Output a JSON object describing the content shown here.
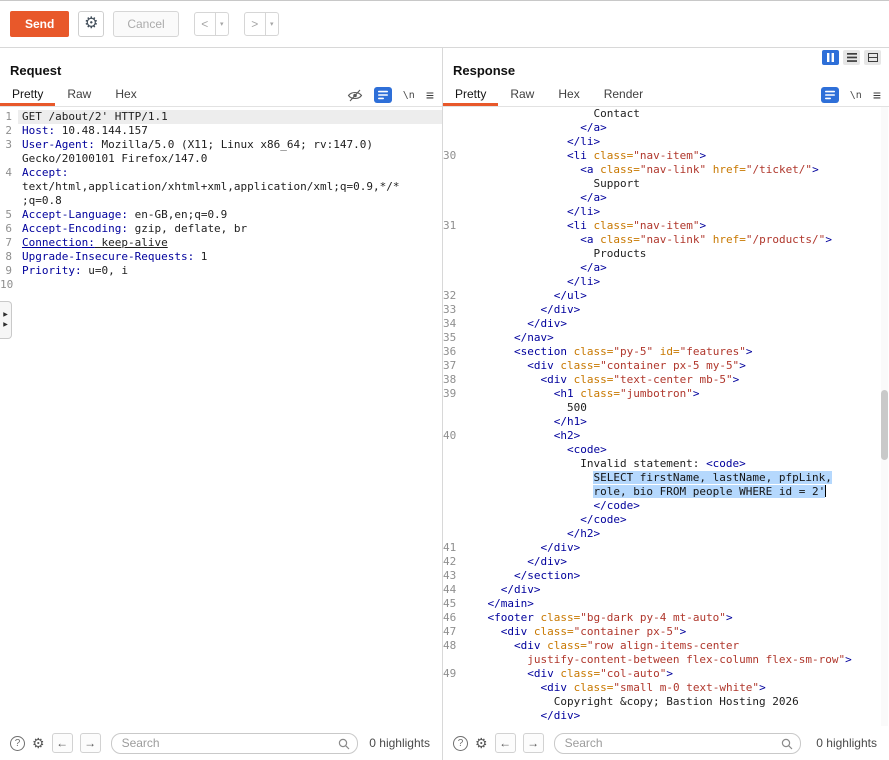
{
  "colors": {
    "accent_orange": "#e8582a",
    "selection_blue": "#b5d8fd",
    "button_blue": "#2e6fd8"
  },
  "icons": {
    "gear_glyph": "⚙",
    "menu_glyph": "≡",
    "newline_label": "\\n",
    "help_glyph": "?",
    "prev_arrow": "←",
    "next_arrow": "→",
    "expand_glyph": "▶"
  },
  "toolbar": {
    "send": "Send",
    "cancel": "Cancel",
    "prev": "<",
    "next": ">",
    "dropdown_caret": "▾"
  },
  "request": {
    "title": "Request",
    "tabs": [
      {
        "label": "Pretty",
        "active": true
      },
      {
        "label": "Raw",
        "active": false
      },
      {
        "label": "Hex",
        "active": false
      }
    ],
    "footer": {
      "search_placeholder": "Search",
      "highlights_label": "0 highlights"
    },
    "lines": [
      {
        "n": "1",
        "hl": true,
        "t": [
          [
            "p",
            "GET /about/2' HTTP/1.1"
          ]
        ]
      },
      {
        "n": "2",
        "t": [
          [
            "h",
            "Host:"
          ],
          [
            "v",
            " 10.48.144.157"
          ]
        ]
      },
      {
        "n": "3",
        "t": [
          [
            "h",
            "User-Agent:"
          ],
          [
            "v",
            " Mozilla/5.0 (X11; Linux x86_64; rv:147.0)"
          ]
        ]
      },
      {
        "n": "",
        "t": [
          [
            "v",
            "Gecko/20100101 Firefox/147.0"
          ]
        ]
      },
      {
        "n": "4",
        "t": [
          [
            "h",
            "Accept:"
          ]
        ]
      },
      {
        "n": "",
        "t": [
          [
            "v",
            "text/html,application/xhtml+xml,application/xml;q=0.9,*/*"
          ]
        ]
      },
      {
        "n": "",
        "t": [
          [
            "v",
            ";q=0.8"
          ]
        ]
      },
      {
        "n": "5",
        "t": [
          [
            "h",
            "Accept-Language:"
          ],
          [
            "v",
            " en-GB,en;q=0.9"
          ]
        ]
      },
      {
        "n": "6",
        "t": [
          [
            "h",
            "Accept-Encoding:"
          ],
          [
            "v",
            " gzip, deflate, br"
          ]
        ]
      },
      {
        "n": "7",
        "t": [
          [
            "hu",
            "Connection:"
          ],
          [
            "vu",
            " keep-alive"
          ]
        ]
      },
      {
        "n": "8",
        "t": [
          [
            "h",
            "Upgrade-Insecure-Requests:"
          ],
          [
            "v",
            " 1"
          ]
        ]
      },
      {
        "n": "9",
        "t": [
          [
            "h",
            "Priority:"
          ],
          [
            "v",
            " u=0, i"
          ]
        ]
      },
      {
        "n": "10",
        "t": []
      }
    ]
  },
  "response": {
    "title": "Response",
    "tabs": [
      {
        "label": "Pretty",
        "active": true
      },
      {
        "label": "Raw",
        "active": false
      },
      {
        "label": "Hex",
        "active": false
      },
      {
        "label": "Render",
        "active": false
      }
    ],
    "footer": {
      "search_placeholder": "Search",
      "highlights_label": "0 highlights"
    },
    "lines": [
      {
        "n": "",
        "i": 20,
        "t": [
          [
            "x",
            "Contact"
          ]
        ]
      },
      {
        "n": "",
        "i": 18,
        "t": [
          [
            "t",
            "</a>"
          ]
        ]
      },
      {
        "n": "",
        "i": 16,
        "t": [
          [
            "t",
            "</li>"
          ]
        ]
      },
      {
        "n": "30",
        "i": 16,
        "t": [
          [
            "t",
            "<li "
          ],
          [
            "a",
            "class="
          ],
          [
            "s",
            "\"nav-item\""
          ],
          [
            "t",
            ">"
          ]
        ]
      },
      {
        "n": "",
        "i": 18,
        "t": [
          [
            "t",
            "<a "
          ],
          [
            "a",
            "class="
          ],
          [
            "s",
            "\"nav-link\""
          ],
          [
            "a",
            " href="
          ],
          [
            "s",
            "\"/ticket/\""
          ],
          [
            "t",
            ">"
          ]
        ]
      },
      {
        "n": "",
        "i": 20,
        "t": [
          [
            "x",
            "Support"
          ]
        ]
      },
      {
        "n": "",
        "i": 18,
        "t": [
          [
            "t",
            "</a>"
          ]
        ]
      },
      {
        "n": "",
        "i": 16,
        "t": [
          [
            "t",
            "</li>"
          ]
        ]
      },
      {
        "n": "31",
        "i": 16,
        "t": [
          [
            "t",
            "<li "
          ],
          [
            "a",
            "class="
          ],
          [
            "s",
            "\"nav-item\""
          ],
          [
            "t",
            ">"
          ]
        ]
      },
      {
        "n": "",
        "i": 18,
        "t": [
          [
            "t",
            "<a "
          ],
          [
            "a",
            "class="
          ],
          [
            "s",
            "\"nav-link\""
          ],
          [
            "a",
            " href="
          ],
          [
            "s",
            "\"/products/\""
          ],
          [
            "t",
            ">"
          ]
        ]
      },
      {
        "n": "",
        "i": 20,
        "t": [
          [
            "x",
            "Products"
          ]
        ]
      },
      {
        "n": "",
        "i": 18,
        "t": [
          [
            "t",
            "</a>"
          ]
        ]
      },
      {
        "n": "",
        "i": 16,
        "t": [
          [
            "t",
            "</li>"
          ]
        ]
      },
      {
        "n": "32",
        "i": 14,
        "t": [
          [
            "t",
            "</ul>"
          ]
        ]
      },
      {
        "n": "33",
        "i": 12,
        "t": [
          [
            "t",
            "</div>"
          ]
        ]
      },
      {
        "n": "34",
        "i": 10,
        "t": [
          [
            "t",
            "</div>"
          ]
        ]
      },
      {
        "n": "35",
        "i": 8,
        "t": [
          [
            "t",
            "</nav>"
          ]
        ]
      },
      {
        "n": "36",
        "i": 8,
        "t": [
          [
            "t",
            "<section "
          ],
          [
            "a",
            "class="
          ],
          [
            "s",
            "\"py-5\""
          ],
          [
            "a",
            " id="
          ],
          [
            "s",
            "\"features\""
          ],
          [
            "t",
            ">"
          ]
        ]
      },
      {
        "n": "37",
        "i": 10,
        "t": [
          [
            "t",
            "<div "
          ],
          [
            "a",
            "class="
          ],
          [
            "s",
            "\"container px-5 my-5\""
          ],
          [
            "t",
            ">"
          ]
        ]
      },
      {
        "n": "38",
        "i": 12,
        "t": [
          [
            "t",
            "<div "
          ],
          [
            "a",
            "class="
          ],
          [
            "s",
            "\"text-center mb-5\""
          ],
          [
            "t",
            ">"
          ]
        ]
      },
      {
        "n": "39",
        "i": 14,
        "t": [
          [
            "t",
            "<h1 "
          ],
          [
            "a",
            "class="
          ],
          [
            "s",
            "\"jumbotron\""
          ],
          [
            "t",
            ">"
          ]
        ]
      },
      {
        "n": "",
        "i": 16,
        "t": [
          [
            "x",
            "500"
          ]
        ]
      },
      {
        "n": "",
        "i": 14,
        "t": [
          [
            "t",
            "</h1>"
          ]
        ]
      },
      {
        "n": "40",
        "i": 14,
        "t": [
          [
            "t",
            "<h2>"
          ]
        ]
      },
      {
        "n": "",
        "i": 16,
        "t": [
          [
            "t",
            "<code>"
          ]
        ]
      },
      {
        "n": "",
        "i": 18,
        "t": [
          [
            "x",
            "Invalid statement: "
          ],
          [
            "t",
            "<code>"
          ]
        ]
      },
      {
        "n": "",
        "i": 20,
        "t": [
          [
            "sel",
            "SELECT firstName, lastName, pfpLink,"
          ]
        ]
      },
      {
        "n": "",
        "i": 20,
        "t": [
          [
            "sel",
            "role, bio FROM people WHERE id = 2'"
          ],
          [
            "caret",
            ""
          ]
        ]
      },
      {
        "n": "",
        "i": 20,
        "t": [
          [
            "t",
            "</code>"
          ]
        ]
      },
      {
        "n": "",
        "i": 18,
        "t": [
          [
            "t",
            "</code>"
          ]
        ]
      },
      {
        "n": "",
        "i": 16,
        "t": [
          [
            "t",
            "</h2>"
          ]
        ]
      },
      {
        "n": "41",
        "i": 12,
        "t": [
          [
            "t",
            "</div>"
          ]
        ]
      },
      {
        "n": "42",
        "i": 10,
        "t": [
          [
            "t",
            "</div>"
          ]
        ]
      },
      {
        "n": "43",
        "i": 8,
        "t": [
          [
            "t",
            "</section>"
          ]
        ]
      },
      {
        "n": "44",
        "i": 6,
        "t": [
          [
            "t",
            "</div>"
          ]
        ]
      },
      {
        "n": "45",
        "i": 4,
        "t": [
          [
            "t",
            "</main>"
          ]
        ]
      },
      {
        "n": "46",
        "i": 4,
        "t": [
          [
            "t",
            "<footer "
          ],
          [
            "a",
            "class="
          ],
          [
            "s",
            "\"bg-dark py-4 mt-auto\""
          ],
          [
            "t",
            ">"
          ]
        ]
      },
      {
        "n": "47",
        "i": 6,
        "t": [
          [
            "t",
            "<div "
          ],
          [
            "a",
            "class="
          ],
          [
            "s",
            "\"container px-5\""
          ],
          [
            "t",
            ">"
          ]
        ]
      },
      {
        "n": "48",
        "i": 8,
        "t": [
          [
            "t",
            "<div "
          ],
          [
            "a",
            "class="
          ],
          [
            "s",
            "\"row align-items-center"
          ]
        ]
      },
      {
        "n": "",
        "i": 10,
        "t": [
          [
            "s",
            "justify-content-between flex-column flex-sm-row\""
          ],
          [
            "t",
            ">"
          ]
        ]
      },
      {
        "n": "49",
        "i": 10,
        "t": [
          [
            "t",
            "<div "
          ],
          [
            "a",
            "class="
          ],
          [
            "s",
            "\"col-auto\""
          ],
          [
            "t",
            ">"
          ]
        ]
      },
      {
        "n": "",
        "i": 12,
        "t": [
          [
            "t",
            "<div "
          ],
          [
            "a",
            "class="
          ],
          [
            "s",
            "\"small m-0 text-white\""
          ],
          [
            "t",
            ">"
          ]
        ]
      },
      {
        "n": "",
        "i": 14,
        "t": [
          [
            "x",
            "Copyright &copy; Bastion Hosting 2026"
          ]
        ]
      },
      {
        "n": "",
        "i": 12,
        "t": [
          [
            "t",
            "</div>"
          ]
        ]
      }
    ]
  }
}
